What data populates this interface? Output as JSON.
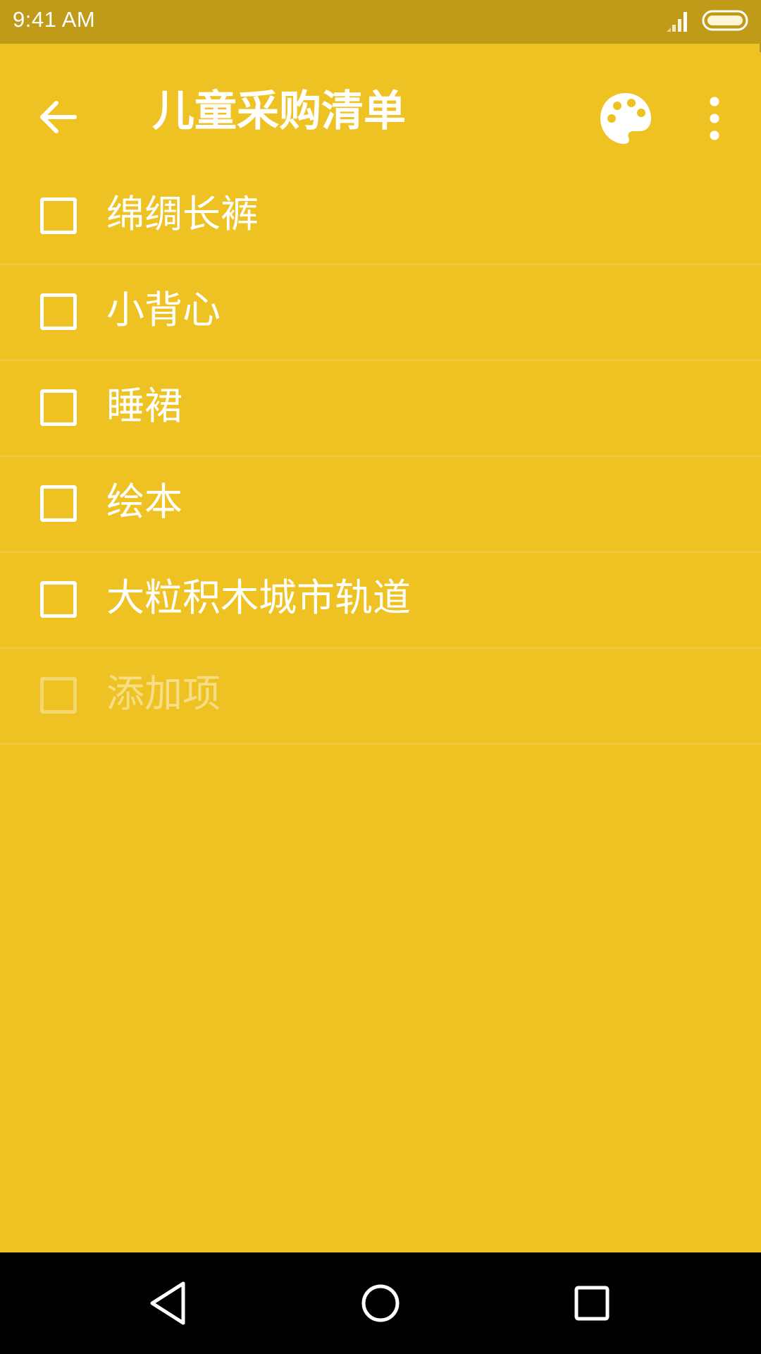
{
  "status_bar": {
    "time": "9:41 AM",
    "signal_icon": "cellular-signal-icon",
    "battery_icon": "battery-icon"
  },
  "toolbar": {
    "back_icon": "arrow-back-icon",
    "title": "儿童采购清单",
    "palette_icon": "palette-icon",
    "more_icon": "more-vertical-icon"
  },
  "checklist": {
    "items": [
      {
        "label": "绵绸长裤",
        "checked": false
      },
      {
        "label": "小背心",
        "checked": false
      },
      {
        "label": "睡裙",
        "checked": false
      },
      {
        "label": "绘本",
        "checked": false
      },
      {
        "label": "大粒积木城市轨道",
        "checked": false
      }
    ],
    "add_item_placeholder": "添加项"
  },
  "nav_bar": {
    "back_icon": "nav-back-triangle-icon",
    "home_icon": "nav-home-circle-icon",
    "recents_icon": "nav-recents-square-icon"
  },
  "colors": {
    "background": "#EFC223",
    "status_bar": "#C09B1A",
    "foreground": "#FFFFFF",
    "nav_bar": "#000000"
  }
}
